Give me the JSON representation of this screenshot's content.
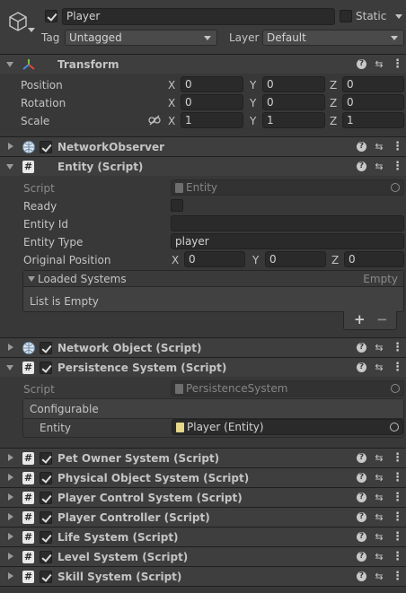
{
  "header": {
    "name": "Player",
    "static_label": "Static",
    "tag_label": "Tag",
    "tag_value": "Untagged",
    "layer_label": "Layer",
    "layer_value": "Default"
  },
  "transform": {
    "title": "Transform",
    "rows": [
      {
        "label": "Position",
        "x": "0",
        "y": "0",
        "z": "0"
      },
      {
        "label": "Rotation",
        "x": "0",
        "y": "0",
        "z": "0"
      },
      {
        "label": "Scale",
        "x": "1",
        "y": "1",
        "z": "1"
      }
    ],
    "axis": {
      "x": "X",
      "y": "Y",
      "z": "Z"
    }
  },
  "network_observer": {
    "title": "NetworkObserver"
  },
  "entity": {
    "title": "Entity (Script)",
    "script_label": "Script",
    "script_value": "Entity",
    "ready_label": "Ready",
    "entity_id_label": "Entity Id",
    "entity_id_value": "",
    "entity_type_label": "Entity Type",
    "entity_type_value": "player",
    "orig_pos_label": "Original Position",
    "orig": {
      "x": "0",
      "y": "0",
      "z": "0"
    },
    "loaded_systems_label": "Loaded Systems",
    "loaded_systems_badge": "Empty",
    "list_empty": "List is Empty",
    "add": "+",
    "remove": "−"
  },
  "network_object": {
    "title": "Network Object (Script)"
  },
  "persistence": {
    "title": "Persistence System (Script)",
    "script_label": "Script",
    "script_value": "PersistenceSystem",
    "configurable_label": "Configurable",
    "entity_label": "Entity",
    "entity_value": "Player (Entity)"
  },
  "components": [
    {
      "title": "Pet Owner System (Script)"
    },
    {
      "title": "Physical Object System (Script)"
    },
    {
      "title": "Player Control System (Script)"
    },
    {
      "title": "Player Controller (Script)"
    },
    {
      "title": "Life System (Script)"
    },
    {
      "title": "Level System (Script)"
    },
    {
      "title": "Skill System (Script)"
    }
  ],
  "icons": {
    "help": "help-icon",
    "presets": "presets-icon",
    "menu": "context-menu-icon"
  },
  "colors": {
    "background": "#383838",
    "header": "#3e3e3e",
    "field": "#2a2a2a"
  }
}
